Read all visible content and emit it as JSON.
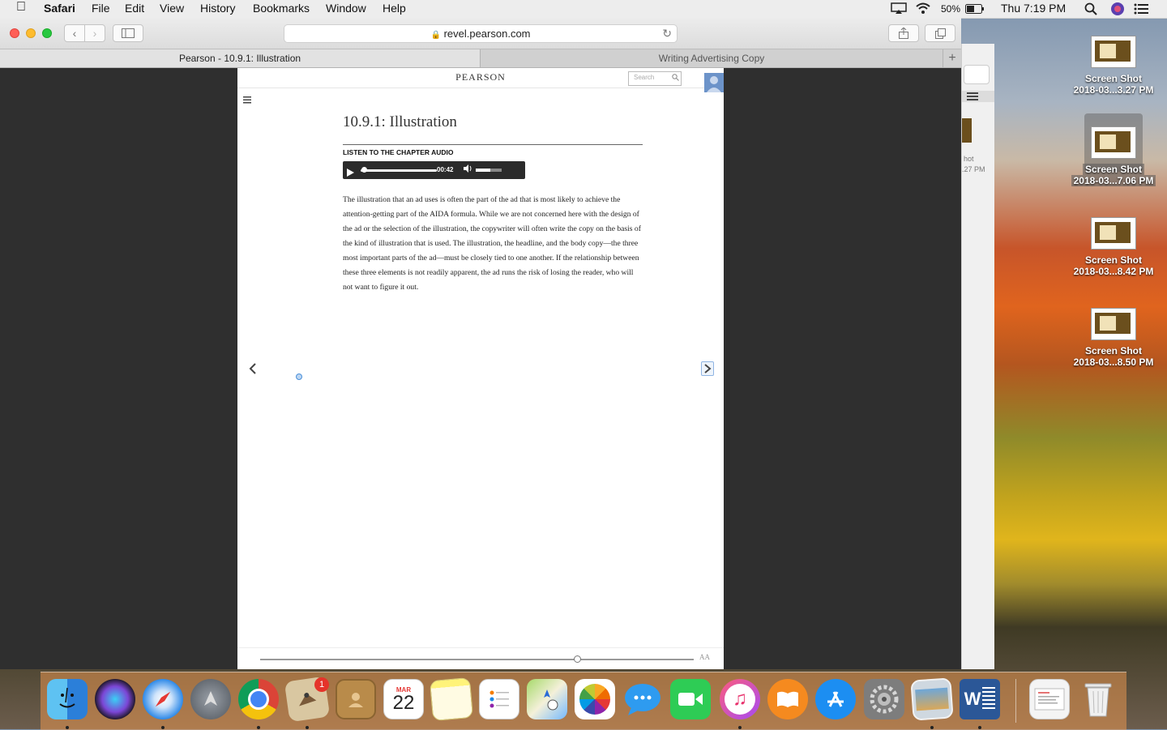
{
  "menubar": {
    "app": "Safari",
    "items": [
      "File",
      "Edit",
      "View",
      "History",
      "Bookmarks",
      "Window",
      "Help"
    ],
    "battery": "50%",
    "clock": "Thu 7:19 PM"
  },
  "safari": {
    "url": "revel.pearson.com",
    "tabs": [
      {
        "label": "Pearson - 10.9.1: Illustration",
        "active": true
      },
      {
        "label": "Writing Advertising Copy",
        "active": false
      }
    ]
  },
  "page": {
    "logo": "PEARSON",
    "search_placeholder": "Search",
    "title": "10.9.1: Illustration",
    "audio_label": "LISTEN TO THE CHAPTER AUDIO",
    "audio_time": "00:42",
    "body": "The illustration that an ad uses is often the part of the ad that is most likely to achieve the attention-getting part of the AIDA formula. While we are not concerned here with the design of the ad or the selection of the illustration, the copywriter will often write the copy on the basis of the kind of illustration that is used. The illustration, the headline, and the body copy—the three most important parts of the ad—must be closely tied to one another. If the relationship between these three elements is not readily apparent, the ad runs the risk of losing the reader, who will not want to figure it out.",
    "font_size_label": "AA"
  },
  "background_window": {
    "fragment_name": "hot",
    "fragment_time": ".27 PM"
  },
  "desktop": {
    "files": [
      {
        "name": "Screen Shot",
        "date": "2018-03...3.27 PM"
      },
      {
        "name": "Screen Shot",
        "date": "2018-03...7.06 PM"
      },
      {
        "name": "Screen Shot",
        "date": "2018-03...8.42 PM"
      },
      {
        "name": "Screen Shot",
        "date": "2018-03...8.50 PM"
      }
    ]
  },
  "dock": {
    "mail_badge": "1",
    "calendar_month": "MAR",
    "calendar_day": "22",
    "word_letter": "W"
  }
}
